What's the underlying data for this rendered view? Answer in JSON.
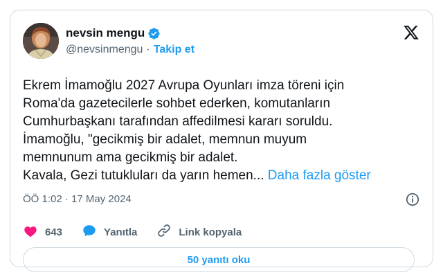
{
  "author": {
    "display_name": "nevsin mengu",
    "handle": "@nevsinmengu",
    "separator": "·",
    "follow_label": "Takip et"
  },
  "tweet": {
    "lines": [
      "Ekrem İmamoğlu 2027 Avrupa Oyunları imza töreni için",
      "Roma'da gazetecilerle sohbet ederken, komutanların",
      "Cumhurbaşkanı tarafından affedilmesi kararı soruldu.",
      "İmamoğlu, \"gecikmiş bir adalet, memnun muyum",
      "memnunum ama gecikmiş bir adalet.",
      "Kavala, Gezi tutukluları da yarın hemen..."
    ],
    "show_more": "Daha fazla göster",
    "timestamp": "ÖÖ 1:02 · 17 May 2024"
  },
  "actions": {
    "likes": "643",
    "reply_label": "Yanıtla",
    "copy_link_label": "Link kopyala"
  },
  "replies_button": "50 yanıtı oku",
  "colors": {
    "accent": "#1d9bf0",
    "like": "#f91880",
    "muted": "#536471",
    "text": "#0f1419",
    "border": "#cfd9de"
  },
  "icons": {
    "verified": "verified-badge-icon",
    "platform": "x-logo-icon",
    "info": "info-icon",
    "like": "heart-icon",
    "reply": "speech-bubble-icon",
    "copy_link": "link-icon"
  }
}
